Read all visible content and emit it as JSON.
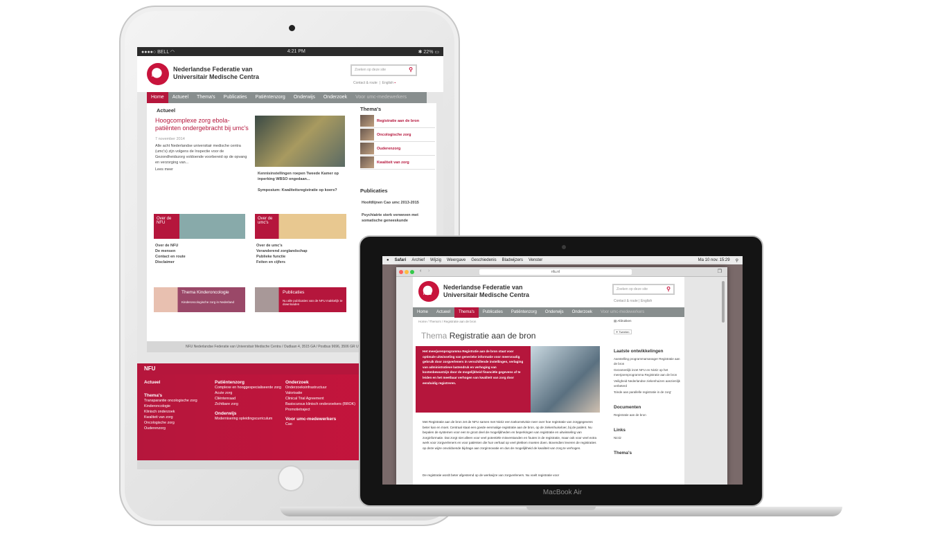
{
  "ipad": {
    "status": {
      "carrier": "BELL",
      "time": "4:21 PM",
      "battery": "22%"
    },
    "logo": {
      "mark": "NFU",
      "line1": "Nederlandse Federatie van",
      "line2": "Universitair Medische Centra"
    },
    "search_placeholder": "Zoeken op deze site",
    "contact": "Contact & route",
    "english": "English",
    "nav": [
      "Home",
      "Actueel",
      "Thema's",
      "Publicaties",
      "Patiëntenzorg",
      "Onderwijs",
      "Onderzoek",
      "Voor umc-medewerkers"
    ],
    "actueel": {
      "heading": "Actueel",
      "title": "Hoogcomplexe zorg ebola-patiënten ondergebracht bij umc's",
      "date": "7 november 2014",
      "body": "Alle acht Nederlandse universitair medische centra (umc's) zijn volgens de Inspectie voor de Gezondheidszorg voldoende voorbereid op de opvang en verzorging van...",
      "more": "Lees meer",
      "news1": "Kennisinstellingen roepen Tweede Kamer op inperking WBSO ongedaan...",
      "news2": "Symposium: Kwaliteitsregistratie op koers?"
    },
    "themas": {
      "heading": "Thema's",
      "items": [
        "Registratie aan de bron",
        "Oncologische zorg",
        "Ouderenzorg",
        "Kwaliteit van zorg"
      ]
    },
    "publicaties": {
      "heading": "Publicaties",
      "items": [
        "Hoofdlijnen Cao umc 2013-2015",
        "Psychiatrie sterk verweven met somatische geneeskunde"
      ]
    },
    "over_nfu": {
      "label": "Over de NFU",
      "links": [
        "Over de NFU",
        "De mensen",
        "Contact en route",
        "Disclaimer"
      ]
    },
    "over_umcs": {
      "label": "Over de umc's",
      "links": [
        "Over de umc's",
        "Veranderend zorglandschap",
        "Publieke functie",
        "Feiten en cijfers"
      ]
    },
    "kinder": {
      "title": "Thema Kinderoncologie",
      "text": "Kinderoncologische zorg in Nederland"
    },
    "pubbox": {
      "title": "Publicaties",
      "text": "Nu alle publicaties van de NFU makkelijk te downloaden"
    },
    "address": "NFU Nederlandse Federatie van Universitair Medische Centra / Oudlaan 4, 3515 GA / Postbus 9696, 3506 GR Utrecht / T 03",
    "footer": {
      "title": "NFU",
      "col1": {
        "h1": "Actueel",
        "h2": "Thema's",
        "items": [
          "Transparantie oncologische zorg",
          "Kinderoncologie",
          "Klinisch onderzoek",
          "Kwaliteit van zorg",
          "Oncologische zorg",
          "Ouderenzorg"
        ]
      },
      "col2": {
        "h1": "Patiëntenzorg",
        "items": [
          "Complexe en hooggespecialiseerde zorg",
          "Acute zorg",
          "Cliëntenraad",
          "Zichtbare zorg"
        ],
        "h2": "Onderwijs",
        "items2": [
          "Modernisering opleidingscurriculum"
        ]
      },
      "col3": {
        "h1": "Onderzoek",
        "items": [
          "Onderzoeksinfrastructuur",
          "Valorisatie",
          "Clinical Trial Agreement",
          "Basiscursus klinisch onderzoekers (BROK)",
          "Promotietraject"
        ],
        "h2": "Voor umc-medewerkers",
        "items2": [
          "Cao"
        ]
      }
    }
  },
  "mac": {
    "menubar": {
      "app": "Safari",
      "items": [
        "Archief",
        "Wijzig",
        "Weergave",
        "Geschiedenis",
        "Bladwijzers",
        "Venster"
      ],
      "clock": "Ma 10 nov.  15:29"
    },
    "url": "nfu.nl",
    "nav": [
      "Home",
      "Actueel",
      "Thema's",
      "Publicaties",
      "Patiëntenzorg",
      "Onderwijs",
      "Onderzoek",
      "Voor umc-medewerkers"
    ],
    "breadcrumb": "Home  /  Thema's  /  Registratie aan de bron",
    "title_prefix": "Thema",
    "title": "Registratie aan de bron",
    "intro": "Het meerjarenprogramma Registratie aan de bron staat voor optimale uitwisseling van generieke informatie voor meervoudig gebruik door zorgverleners in verschillende instellingen, verlaging van administratieve lastendruk en verhoging van kostenbewustzijn door de mogelijkheid financiële gegevens af te leiden en het meetbaar verhogen van kwaliteit van zorg door eenduidig registreren.",
    "body": "Met Registratie aan de bron zet de NFU samen met Nictiz een toekomstvisie neer over hoe registratie van zorggegevens beter kan en moet. Centraal staat een goede eenmalige registratie aan de bron, op de ziekenhuisvloer, bij de patiënt. Nu bepalen de systemen voor een te groot deel de mogelijkheden en beperkingen van registratie en uitwisseling van zorginformatie. Dat zorgt niet alleen voor veel potentiële misverstanden en fouten in de registratie, maar ook voor veel extra werk voor zorgverleners en voor patiënten die hun verhaal op veel plekken moeten doen. Bovendien leveren de registraties op deze wijze onvoldoende bijdrage aan zorginnovatie en dus de mogelijkheid de kwaliteit van zorg te verhogen.",
    "body2": "De registratie wordt beter afgestemd op de werkwijze van zorgverleners. Nu voelt registratie voor",
    "side": {
      "print": "Afdrukken",
      "tweet": "Tweeten",
      "h1": "Laatste ontwikkelingen",
      "items1": [
        "Aanstelling programmamanager Registratie aan de bron",
        "Gezamenlijk inzet NFU en Nictiz op het meerjarenprogramma Registratie aan de bron",
        "Veiligheid Nederlandse ziekenhuizen aanzienlijk verbeterd",
        "'Einde aan parallelle registratie in de zorg'"
      ],
      "h2": "Documenten",
      "items2": [
        "Registratie aan de bron"
      ],
      "h3": "Links",
      "items3": [
        "Nictiz"
      ],
      "h4": "Thema's"
    },
    "brand": "MacBook Air"
  }
}
